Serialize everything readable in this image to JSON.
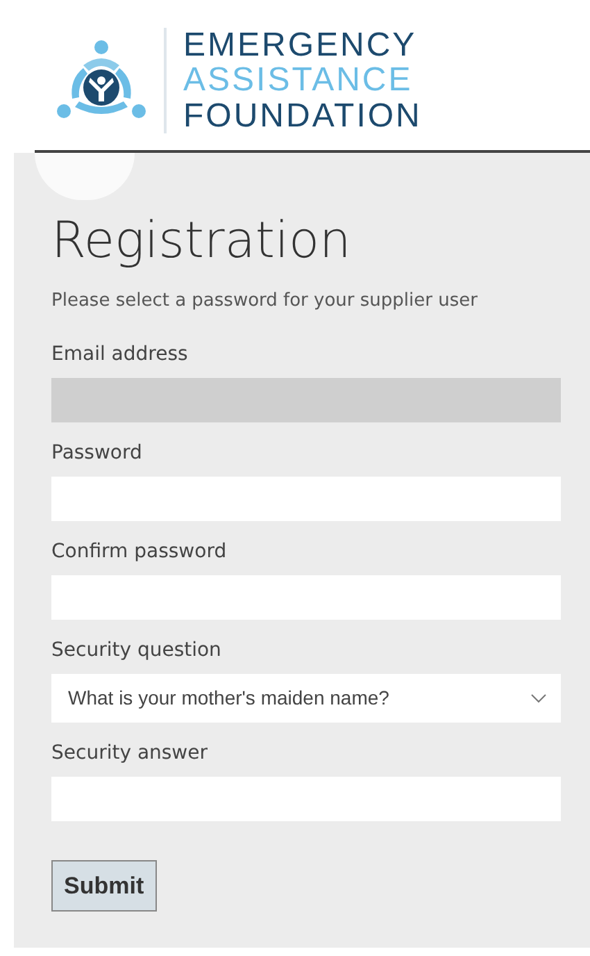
{
  "logo": {
    "lines": [
      "EMERGENCY",
      "ASSISTANCE",
      "FOUNDATION"
    ]
  },
  "form": {
    "title": "Registration",
    "subtitle": "Please select a password for your supplier user",
    "fields": [
      {
        "kind": "text",
        "label": "Email address",
        "disabled": true
      },
      {
        "kind": "password",
        "label": "Password",
        "disabled": false
      },
      {
        "kind": "password",
        "label": "Confirm password",
        "disabled": false
      },
      {
        "kind": "select",
        "label": "Security question",
        "value": "What is your mother's maiden name?",
        "disabled": false
      },
      {
        "kind": "text",
        "label": "Security answer",
        "disabled": false
      }
    ],
    "submit": "Submit"
  }
}
